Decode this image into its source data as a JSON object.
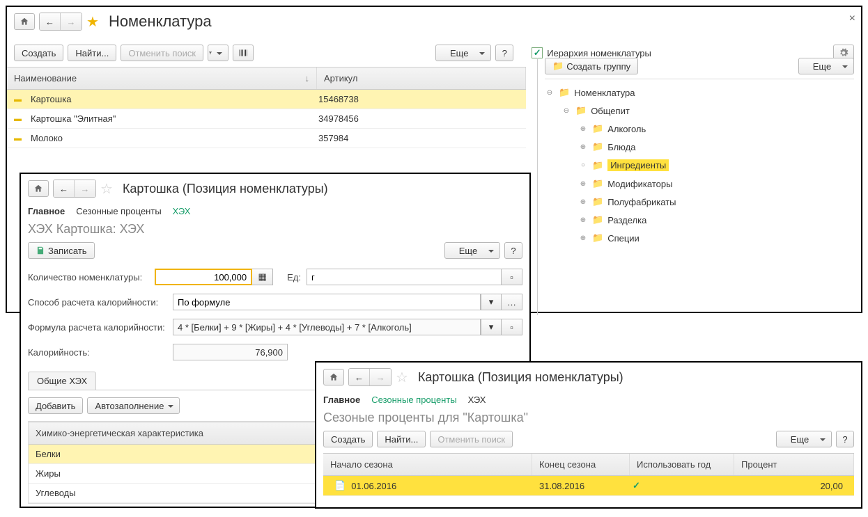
{
  "main": {
    "title": "Номенклатура",
    "buttons": {
      "create": "Создать",
      "find": "Найти...",
      "cancel_search": "Отменить поиск",
      "more": "Еще",
      "help": "?"
    },
    "columns": {
      "name": "Наименование",
      "article": "Артикул"
    },
    "rows": [
      {
        "name": "Картошка",
        "article": "15468738",
        "selected": true
      },
      {
        "name": "Картошка \"Элитная\"",
        "article": "34978456"
      },
      {
        "name": "Молоко",
        "article": "357984"
      }
    ],
    "hierarchy": {
      "checkbox": true,
      "label": "Иерархия номенклатуры",
      "create_group": "Создать группу",
      "more": "Еще"
    },
    "tree": {
      "root": "Номенклатура",
      "group": "Общепит",
      "items": [
        "Алкоголь",
        "Блюда",
        "Ингредиенты",
        "Модификаторы",
        "Полуфабрикаты",
        "Разделка",
        "Специи"
      ],
      "highlight": "Ингредиенты"
    }
  },
  "hex": {
    "title": "Картошка (Позиция номенклатуры)",
    "tabs": {
      "main": "Главное",
      "seasonal": "Сезонные проценты",
      "hex": "ХЭХ"
    },
    "subtitle": "ХЭХ Картошка: ХЭХ",
    "save": "Записать",
    "more": "Еще",
    "help": "?",
    "fields": {
      "qty_label": "Количество номенклатуры:",
      "qty_value": "100,000",
      "unit_label": "Ед:",
      "unit_value": "г",
      "method_label": "Способ расчета калорийности:",
      "method_value": "По формуле",
      "formula_label": "Формула расчета калорийности:",
      "formula_value": "4 * [Белки] + 9 * [Жиры] + 4 * [Углеводы] + 7 * [Алкоголь]",
      "kcal_label": "Калорийность:",
      "kcal_value": "76,900"
    },
    "subtab": "Общие ХЭХ",
    "add": "Добавить",
    "autofill": "Автозаполнение",
    "list_header": "Химико-энергетическая характеристика",
    "list": [
      "Белки",
      "Жиры",
      "Углеводы"
    ],
    "list_selected": "Белки"
  },
  "season": {
    "title": "Картошка (Позиция номенклатуры)",
    "tabs": {
      "main": "Главное",
      "seasonal": "Сезонные проценты",
      "hex": "ХЭХ"
    },
    "subtitle": "Сезоные проценты для \"Картошка\"",
    "buttons": {
      "create": "Создать",
      "find": "Найти...",
      "cancel_search": "Отменить поиск",
      "more": "Еще",
      "help": "?"
    },
    "columns": {
      "start": "Начало сезона",
      "end": "Конец сезона",
      "use_year": "Использовать год",
      "percent": "Процент"
    },
    "row": {
      "start": "01.06.2016",
      "end": "31.08.2016",
      "use_year": true,
      "percent": "20,00"
    }
  }
}
